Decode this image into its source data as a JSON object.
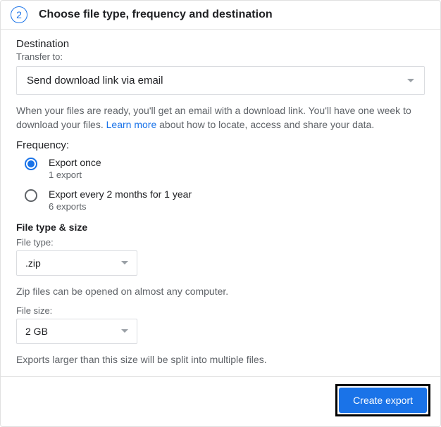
{
  "step": {
    "number": "2",
    "title": "Choose file type, frequency and destination"
  },
  "destination": {
    "section_title": "Destination",
    "field_label": "Transfer to:",
    "selected": "Send download link via email",
    "help_before": "When your files are ready, you'll get an email with a download link. You'll have one week to download your files. ",
    "learn_more": "Learn more",
    "help_after": " about how to locate, access and share your data."
  },
  "frequency": {
    "section_title": "Frequency:",
    "options": [
      {
        "label": "Export once",
        "sub": "1 export",
        "selected": true
      },
      {
        "label": "Export every 2 months for 1 year",
        "sub": "6 exports",
        "selected": false
      }
    ]
  },
  "file_section": {
    "title": "File type & size",
    "file_type_label": "File type:",
    "file_type_value": ".zip",
    "file_type_help": "Zip files can be opened on almost any computer.",
    "file_size_label": "File size:",
    "file_size_value": "2 GB",
    "file_size_help": "Exports larger than this size will be split into multiple files."
  },
  "footer": {
    "create_button": "Create export"
  }
}
